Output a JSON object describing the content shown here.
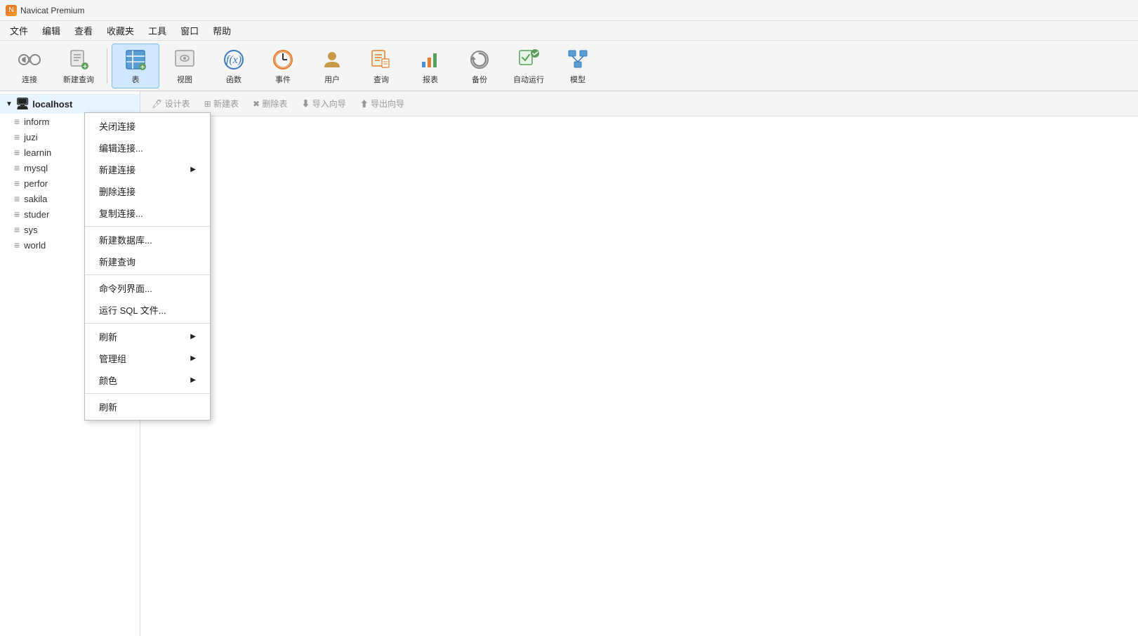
{
  "app": {
    "title": "Navicat Premium"
  },
  "menubar": {
    "items": [
      "文件",
      "编辑",
      "查看",
      "收藏夹",
      "工具",
      "窗口",
      "帮助"
    ]
  },
  "toolbar": {
    "buttons": [
      {
        "id": "connect",
        "label": "连接",
        "icon": "🔌"
      },
      {
        "id": "new-query",
        "label": "新建查询",
        "icon": "📋"
      },
      {
        "id": "table",
        "label": "表",
        "icon": "🗃"
      },
      {
        "id": "view",
        "label": "视图",
        "icon": "👁"
      },
      {
        "id": "function",
        "label": "函数",
        "icon": "ƒ"
      },
      {
        "id": "event",
        "label": "事件",
        "icon": "⏰"
      },
      {
        "id": "user",
        "label": "用户",
        "icon": "👤"
      },
      {
        "id": "query",
        "label": "查询",
        "icon": "📊"
      },
      {
        "id": "report",
        "label": "报表",
        "icon": "📈"
      },
      {
        "id": "backup",
        "label": "备份",
        "icon": "🔄"
      },
      {
        "id": "autorun",
        "label": "自动运行",
        "icon": "✅"
      },
      {
        "id": "model",
        "label": "模型",
        "icon": "🗂"
      }
    ]
  },
  "sidebar": {
    "connection": {
      "label": "localhost",
      "expanded": true
    },
    "databases": [
      {
        "name": "inform"
      },
      {
        "name": "juzi"
      },
      {
        "name": "learnin"
      },
      {
        "name": "mysql"
      },
      {
        "name": "perfor"
      },
      {
        "name": "sakila"
      },
      {
        "name": "studer"
      },
      {
        "name": "sys"
      },
      {
        "name": "world"
      }
    ]
  },
  "secondary_toolbar": {
    "buttons": [
      {
        "id": "design-table",
        "label": "设计表",
        "enabled": false
      },
      {
        "id": "new-table",
        "label": "新建表",
        "enabled": false
      },
      {
        "id": "delete-table",
        "label": "删除表",
        "enabled": false
      },
      {
        "id": "import-wizard",
        "label": "导入向导",
        "enabled": false
      },
      {
        "id": "export-wizard",
        "label": "导出向导",
        "enabled": false
      }
    ]
  },
  "context_menu": {
    "items": [
      {
        "id": "close-connection",
        "label": "关闭连接",
        "has_sub": false,
        "separator_after": false
      },
      {
        "id": "edit-connection",
        "label": "编辑连接...",
        "has_sub": false,
        "separator_after": false
      },
      {
        "id": "new-connection",
        "label": "新建连接",
        "has_sub": true,
        "separator_after": false
      },
      {
        "id": "delete-connection",
        "label": "删除连接",
        "has_sub": false,
        "separator_after": false
      },
      {
        "id": "copy-connection",
        "label": "复制连接...",
        "has_sub": false,
        "separator_after": true
      },
      {
        "id": "new-database",
        "label": "新建数据库...",
        "has_sub": false,
        "separator_after": false
      },
      {
        "id": "new-query-ctx",
        "label": "新建查询",
        "has_sub": false,
        "separator_after": true
      },
      {
        "id": "command-line",
        "label": "命令列界面...",
        "has_sub": false,
        "separator_after": false
      },
      {
        "id": "run-sql",
        "label": "运行 SQL 文件...",
        "has_sub": false,
        "separator_after": true
      },
      {
        "id": "refresh-sub",
        "label": "刷新",
        "has_sub": true,
        "separator_after": false
      },
      {
        "id": "manage-group",
        "label": "管理组",
        "has_sub": true,
        "separator_after": false
      },
      {
        "id": "color",
        "label": "颜色",
        "has_sub": true,
        "separator_after": true
      },
      {
        "id": "refresh",
        "label": "刷新",
        "has_sub": false,
        "separator_after": false
      }
    ]
  }
}
